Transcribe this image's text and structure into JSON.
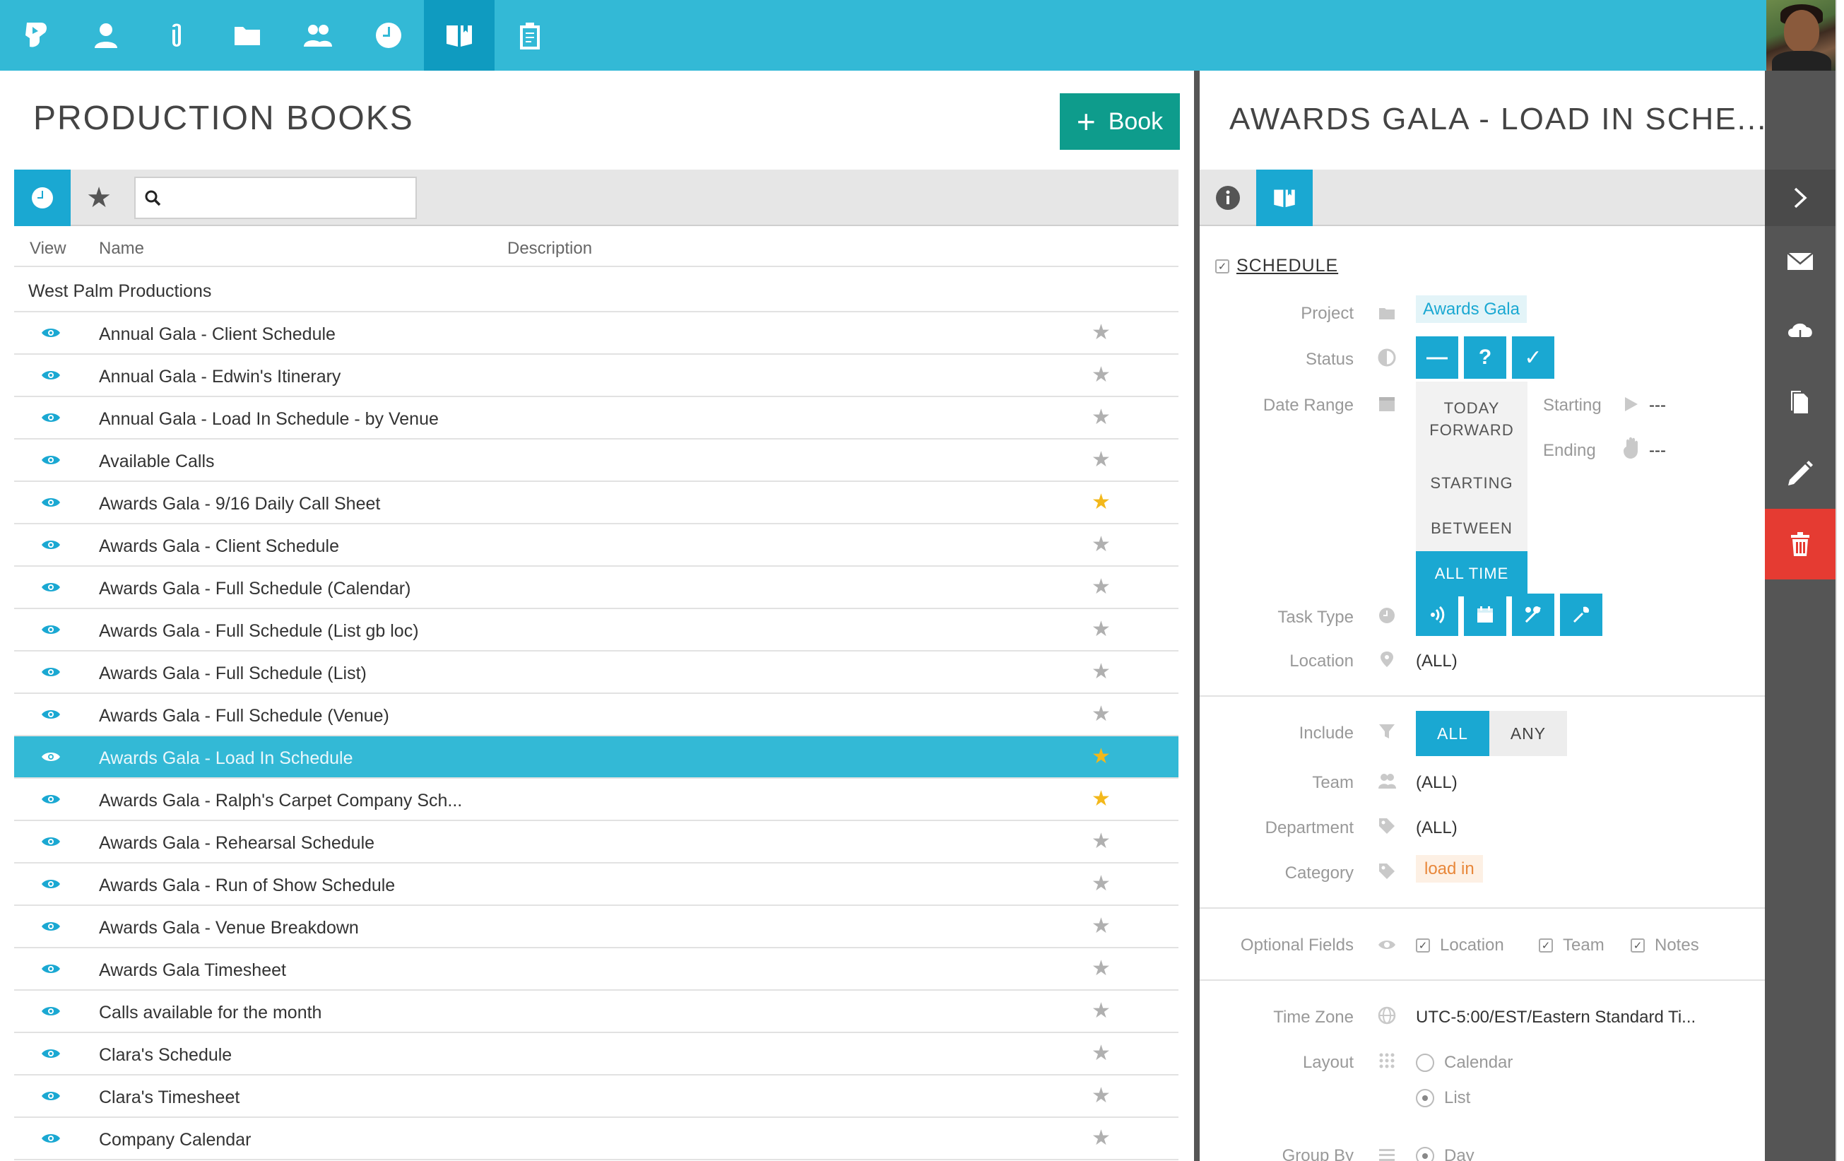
{
  "nav": {
    "items": [
      "logo-icon",
      "user-icon",
      "paperclip-icon",
      "folder-icon",
      "team-icon",
      "clock-icon",
      "book-icon",
      "clipboard-icon"
    ],
    "active": "book-icon"
  },
  "left": {
    "title": "PRODUCTION BOOKS",
    "add_button": "Book",
    "search": {
      "value": "",
      "placeholder": ""
    },
    "columns": {
      "view": "View",
      "name": "Name",
      "description": "Description"
    },
    "group": "West Palm Productions",
    "rows": [
      {
        "name": "Annual Gala - Client Schedule",
        "favorite": false
      },
      {
        "name": "Annual Gala - Edwin's Itinerary",
        "favorite": false
      },
      {
        "name": "Annual Gala - Load In Schedule - by Venue",
        "favorite": false
      },
      {
        "name": "Available Calls",
        "favorite": false
      },
      {
        "name": "Awards Gala - 9/16 Daily Call Sheet",
        "favorite": true
      },
      {
        "name": "Awards Gala - Client Schedule",
        "favorite": false
      },
      {
        "name": "Awards Gala - Full Schedule (Calendar)",
        "favorite": false
      },
      {
        "name": "Awards Gala - Full Schedule (List gb loc)",
        "favorite": false
      },
      {
        "name": "Awards Gala - Full Schedule (List)",
        "favorite": false
      },
      {
        "name": "Awards Gala - Full Schedule (Venue)",
        "favorite": false
      },
      {
        "name": "Awards Gala - Load In Schedule",
        "favorite": true,
        "selected": true
      },
      {
        "name": "Awards Gala - Ralph's Carpet Company Sch...",
        "favorite": true
      },
      {
        "name": "Awards Gala - Rehearsal Schedule",
        "favorite": false
      },
      {
        "name": "Awards Gala - Run of Show Schedule",
        "favorite": false
      },
      {
        "name": "Awards Gala - Venue Breakdown",
        "favorite": false
      },
      {
        "name": "Awards Gala Timesheet",
        "favorite": false
      },
      {
        "name": "Calls available for the month",
        "favorite": false
      },
      {
        "name": "Clara's Schedule",
        "favorite": false
      },
      {
        "name": "Clara's Timesheet",
        "favorite": false
      },
      {
        "name": "Company Calendar",
        "favorite": false
      }
    ]
  },
  "detail": {
    "title": "AWARDS GALA - LOAD IN SCHE...",
    "schedule_label": "SCHEDULE",
    "project": {
      "label": "Project",
      "value": "Awards Gala"
    },
    "status": {
      "label": "Status",
      "buttons": [
        "—",
        "?",
        "✓"
      ]
    },
    "date_range": {
      "label": "Date Range",
      "options": [
        "TODAY FORWARD",
        "STARTING",
        "BETWEEN",
        "ALL TIME"
      ],
      "selected": "ALL TIME",
      "starting_label": "Starting",
      "starting_value": "---",
      "ending_label": "Ending",
      "ending_value": "---"
    },
    "task_type": {
      "label": "Task Type",
      "icons": [
        "signal-icon",
        "calendar-icon",
        "tools-icon",
        "wrench-icon"
      ]
    },
    "location": {
      "label": "Location",
      "value": "(ALL)"
    },
    "include": {
      "label": "Include",
      "options": [
        "ALL",
        "ANY"
      ],
      "selected": "ALL"
    },
    "team": {
      "label": "Team",
      "value": "(ALL)"
    },
    "department": {
      "label": "Department",
      "value": "(ALL)"
    },
    "category": {
      "label": "Category",
      "value": "load in"
    },
    "optional_fields": {
      "label": "Optional Fields",
      "options": [
        "Location",
        "Team",
        "Notes"
      ]
    },
    "time_zone": {
      "label": "Time Zone",
      "value": "UTC-5:00/EST/Eastern Standard Ti..."
    },
    "layout": {
      "label": "Layout",
      "options": [
        "Calendar",
        "List"
      ],
      "selected": "List"
    },
    "group_by": {
      "label": "Group By",
      "value": "Day"
    }
  },
  "actions": [
    "chevron-right-icon",
    "mail-icon",
    "cloud-download-icon",
    "copy-icon",
    "pencil-icon",
    "trash-icon"
  ],
  "colors": {
    "nav": "#33b9d6",
    "accent": "#1aa8d2",
    "add_button": "#0e9c8c",
    "delete": "#e53b32",
    "favorite": "#f3b81b"
  }
}
